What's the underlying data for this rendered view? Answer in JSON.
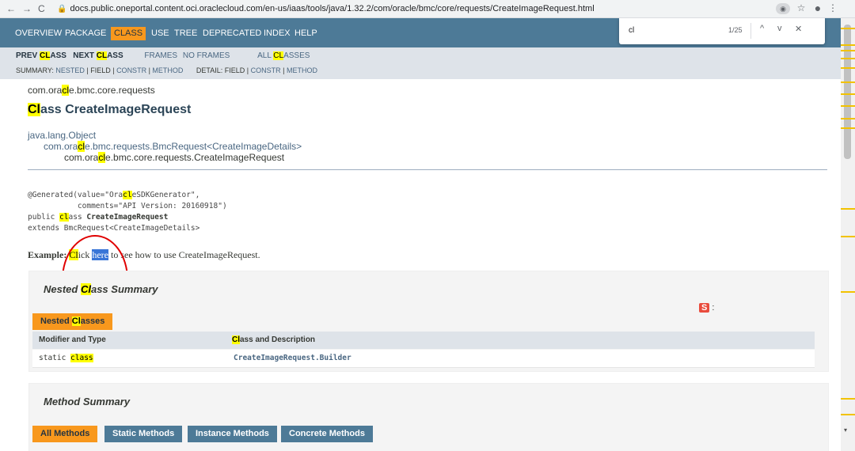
{
  "browser": {
    "back": "←",
    "forward": "→",
    "reload": "C",
    "url": "docs.public.oneportal.content.oci.oraclecloud.com/en-us/iaas/tools/java/1.32.2/com/oracle/bmc/core/requests/CreateImageRequest.html",
    "star": "☆",
    "menu": "⋮"
  },
  "find": {
    "query": "cl",
    "count": "1/25",
    "prev": "^",
    "next": "v",
    "close": "✕"
  },
  "topnav": {
    "overview": "OVERVIEW",
    "package": "PACKAGE",
    "class": "CLASS",
    "use": "USE",
    "tree": "TREE",
    "deprecated": "DEPRECATED",
    "index": "INDEX",
    "help": "HELP"
  },
  "subnav": {
    "prev_a": "PREV ",
    "prev_hl": "CL",
    "prev_b": "ASS",
    "next_a": "NEXT ",
    "next_hl": "CL",
    "next_b": "ASS",
    "frames": "FRAMES",
    "noframes": "NO FRAMES",
    "all_a": "ALL ",
    "all_hl": "CL",
    "all_b": "ASSES",
    "summary_label": "SUMMARY: ",
    "summary_nested": "NESTED",
    "summary_field": "FIELD",
    "summary_constr": "CONSTR",
    "summary_method": "METHOD",
    "detail_label": "DETAIL: ",
    "detail_field": "FIELD",
    "detail_constr": "CONSTR",
    "detail_method": "METHOD",
    "sep": " | "
  },
  "package": {
    "a": "com.ora",
    "hl": "cl",
    "b": "e.bmc.core.requests"
  },
  "title": {
    "hl": "Cl",
    "rest": "ass CreateImageRequest"
  },
  "hierarchy": {
    "l1": "java.lang.Object",
    "l2a": "com.ora",
    "l2hl": "cl",
    "l2b": "e.bmc.requests.BmcRequest<CreateImageDetails>",
    "l3a": "com.ora",
    "l3hl": "cl",
    "l3b": "e.bmc.core.requests.CreateImageRequest"
  },
  "signature": {
    "gen_a": "@Generated(value=\"Ora",
    "gen_hl": "cl",
    "gen_b": "eSDKGenerator\",",
    "gen_c": "           comments=\"API Version: 20160918\")",
    "pub_a": "public ",
    "pub_hl": "cl",
    "pub_b": "ass ",
    "pub_name": "CreateImageRequest",
    "ext": "extends BmcRequest<CreateImageDetails>"
  },
  "example": {
    "label": "Example: ",
    "hl": "Cl",
    "text1": "ick ",
    "link": "here",
    "text2": " to see how to use CreateImageRequest."
  },
  "nested": {
    "title_a": "Nested ",
    "title_hl": "Cl",
    "title_b": "ass Summary",
    "tab_a": "Nested ",
    "tab_hl": "Cl",
    "tab_b": "asses",
    "col1": "Modifier and Type",
    "col2_hl": "Cl",
    "col2_b": "ass and Description",
    "row_mod_a": "static ",
    "row_mod_hl": "class",
    "row_name": "CreateImageRequest.Builder",
    "ext_icon_label": "S",
    "ext_icon_dots": ":"
  },
  "methods": {
    "title": "Method Summary",
    "tabs": [
      "All Methods",
      "Static Methods",
      "Instance Methods",
      "Concrete Methods"
    ]
  },
  "colors": {
    "nav": "#4d7a97",
    "accent": "#f8981d",
    "highlight": "#ffff00",
    "circle": "#e00000"
  }
}
